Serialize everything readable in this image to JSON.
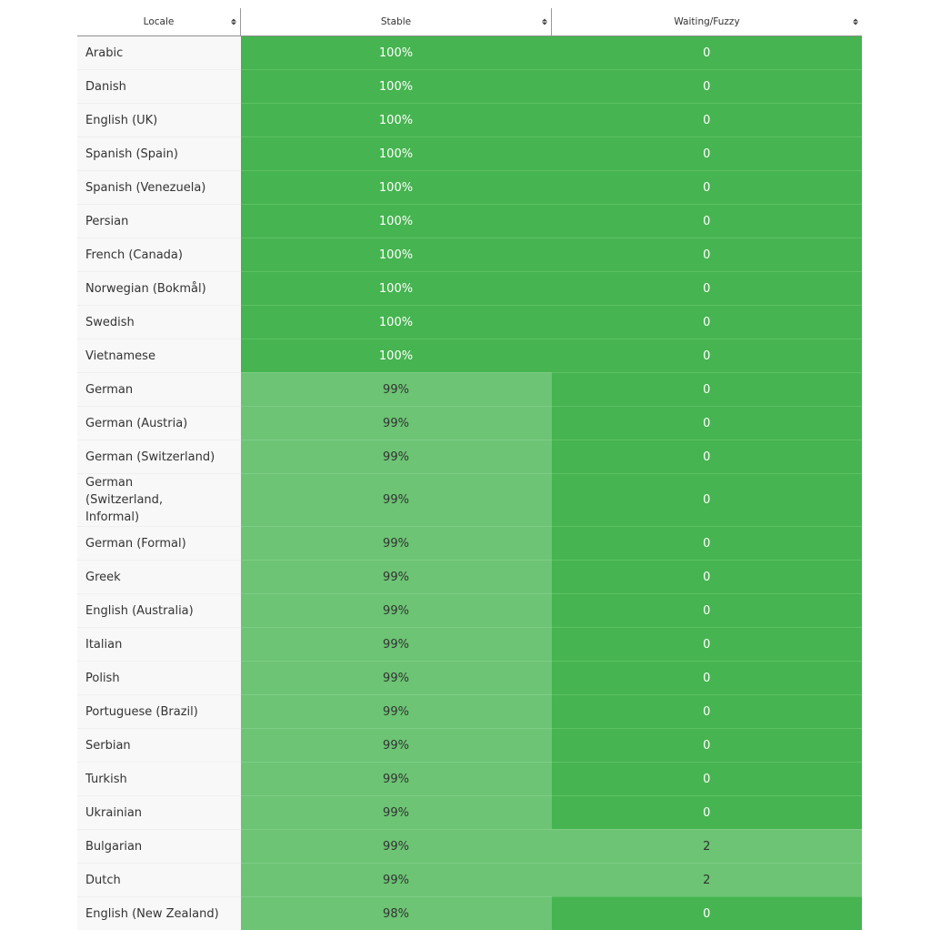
{
  "table": {
    "headers": [
      {
        "label": "Locale",
        "sort_icon": "sort-icon"
      },
      {
        "label": "Stable",
        "sort_icon": "sort-icon"
      },
      {
        "label": "Waiting/Fuzzy",
        "sort_icon": "sort-icon"
      }
    ],
    "colors": {
      "complete": "#46b450",
      "partial": "#6cc474"
    },
    "rows": [
      {
        "locale": "Arabic",
        "stable": "100%",
        "waiting": "0",
        "stable_status": "complete",
        "waiting_status": "complete"
      },
      {
        "locale": "Danish",
        "stable": "100%",
        "waiting": "0",
        "stable_status": "complete",
        "waiting_status": "complete"
      },
      {
        "locale": "English (UK)",
        "stable": "100%",
        "waiting": "0",
        "stable_status": "complete",
        "waiting_status": "complete"
      },
      {
        "locale": "Spanish (Spain)",
        "stable": "100%",
        "waiting": "0",
        "stable_status": "complete",
        "waiting_status": "complete"
      },
      {
        "locale": "Spanish (Venezuela)",
        "stable": "100%",
        "waiting": "0",
        "stable_status": "complete",
        "waiting_status": "complete"
      },
      {
        "locale": "Persian",
        "stable": "100%",
        "waiting": "0",
        "stable_status": "complete",
        "waiting_status": "complete"
      },
      {
        "locale": "French (Canada)",
        "stable": "100%",
        "waiting": "0",
        "stable_status": "complete",
        "waiting_status": "complete"
      },
      {
        "locale": "Norwegian (Bokmål)",
        "stable": "100%",
        "waiting": "0",
        "stable_status": "complete",
        "waiting_status": "complete"
      },
      {
        "locale": "Swedish",
        "stable": "100%",
        "waiting": "0",
        "stable_status": "complete",
        "waiting_status": "complete"
      },
      {
        "locale": "Vietnamese",
        "stable": "100%",
        "waiting": "0",
        "stable_status": "complete",
        "waiting_status": "complete"
      },
      {
        "locale": "German",
        "stable": "99%",
        "waiting": "0",
        "stable_status": "partial",
        "waiting_status": "complete"
      },
      {
        "locale": "German (Austria)",
        "stable": "99%",
        "waiting": "0",
        "stable_status": "partial",
        "waiting_status": "complete"
      },
      {
        "locale": "German (Switzerland)",
        "stable": "99%",
        "waiting": "0",
        "stable_status": "partial",
        "waiting_status": "complete"
      },
      {
        "locale": "German (Switzerland, Informal)",
        "stable": "99%",
        "waiting": "0",
        "stable_status": "partial",
        "waiting_status": "complete"
      },
      {
        "locale": "German (Formal)",
        "stable": "99%",
        "waiting": "0",
        "stable_status": "partial",
        "waiting_status": "complete"
      },
      {
        "locale": "Greek",
        "stable": "99%",
        "waiting": "0",
        "stable_status": "partial",
        "waiting_status": "complete"
      },
      {
        "locale": "English (Australia)",
        "stable": "99%",
        "waiting": "0",
        "stable_status": "partial",
        "waiting_status": "complete"
      },
      {
        "locale": "Italian",
        "stable": "99%",
        "waiting": "0",
        "stable_status": "partial",
        "waiting_status": "complete"
      },
      {
        "locale": "Polish",
        "stable": "99%",
        "waiting": "0",
        "stable_status": "partial",
        "waiting_status": "complete"
      },
      {
        "locale": "Portuguese (Brazil)",
        "stable": "99%",
        "waiting": "0",
        "stable_status": "partial",
        "waiting_status": "complete"
      },
      {
        "locale": "Serbian",
        "stable": "99%",
        "waiting": "0",
        "stable_status": "partial",
        "waiting_status": "complete"
      },
      {
        "locale": "Turkish",
        "stable": "99%",
        "waiting": "0",
        "stable_status": "partial",
        "waiting_status": "complete"
      },
      {
        "locale": "Ukrainian",
        "stable": "99%",
        "waiting": "0",
        "stable_status": "partial",
        "waiting_status": "complete"
      },
      {
        "locale": "Bulgarian",
        "stable": "99%",
        "waiting": "2",
        "stable_status": "partial",
        "waiting_status": "partial"
      },
      {
        "locale": "Dutch",
        "stable": "99%",
        "waiting": "2",
        "stable_status": "partial",
        "waiting_status": "partial"
      },
      {
        "locale": "English (New Zealand)",
        "stable": "98%",
        "waiting": "0",
        "stable_status": "partial",
        "waiting_status": "complete"
      }
    ]
  }
}
